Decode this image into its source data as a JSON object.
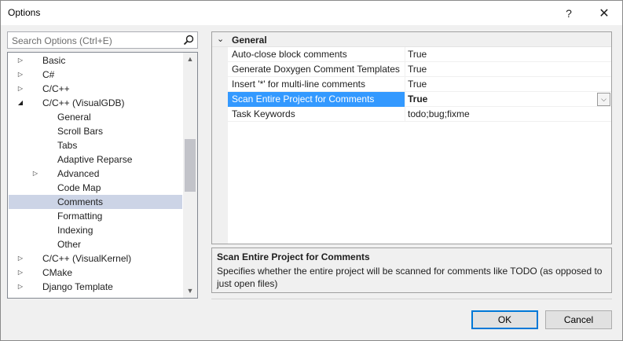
{
  "window": {
    "title": "Options",
    "help_label": "?",
    "close_label": "✕"
  },
  "search": {
    "placeholder": "Search Options (Ctrl+E)"
  },
  "tree": {
    "items": [
      {
        "label": "Basic",
        "expander": "collapsed",
        "level": 0
      },
      {
        "label": "C#",
        "expander": "collapsed",
        "level": 0
      },
      {
        "label": "C/C++",
        "expander": "collapsed",
        "level": 0
      },
      {
        "label": "C/C++ (VisualGDB)",
        "expander": "expanded",
        "level": 0
      },
      {
        "label": "General",
        "expander": "none",
        "level": 1
      },
      {
        "label": "Scroll Bars",
        "expander": "none",
        "level": 1
      },
      {
        "label": "Tabs",
        "expander": "none",
        "level": 1
      },
      {
        "label": "Adaptive Reparse",
        "expander": "none",
        "level": 1
      },
      {
        "label": "Advanced",
        "expander": "collapsed",
        "level": 1
      },
      {
        "label": "Code Map",
        "expander": "none",
        "level": 1
      },
      {
        "label": "Comments",
        "expander": "none",
        "level": 1,
        "selected": true
      },
      {
        "label": "Formatting",
        "expander": "none",
        "level": 1
      },
      {
        "label": "Indexing",
        "expander": "none",
        "level": 1
      },
      {
        "label": "Other",
        "expander": "none",
        "level": 1
      },
      {
        "label": "C/C++ (VisualKernel)",
        "expander": "collapsed",
        "level": 0
      },
      {
        "label": "CMake",
        "expander": "collapsed",
        "level": 0
      },
      {
        "label": "Django Template",
        "expander": "collapsed",
        "level": 0
      }
    ]
  },
  "grid": {
    "category": "General",
    "properties": [
      {
        "name": "Auto-close block comments",
        "value": "True"
      },
      {
        "name": "Generate Doxygen Comment Templates",
        "value": "True"
      },
      {
        "name": "Insert '*' for multi-line comments",
        "value": "True"
      },
      {
        "name": "Scan Entire Project for Comments",
        "value": "True",
        "selected": true
      },
      {
        "name": "Task Keywords",
        "value": "todo;bug;fixme"
      }
    ]
  },
  "description": {
    "title": "Scan Entire Project for Comments",
    "text": "Specifies whether the entire project will be scanned for comments like TODO (as opposed to just open files)"
  },
  "buttons": {
    "ok": "OK",
    "cancel": "Cancel"
  },
  "colors": {
    "selection_blue": "#3399ff",
    "tree_selection": "#ccd4e6",
    "default_button_border": "#0078d7"
  }
}
